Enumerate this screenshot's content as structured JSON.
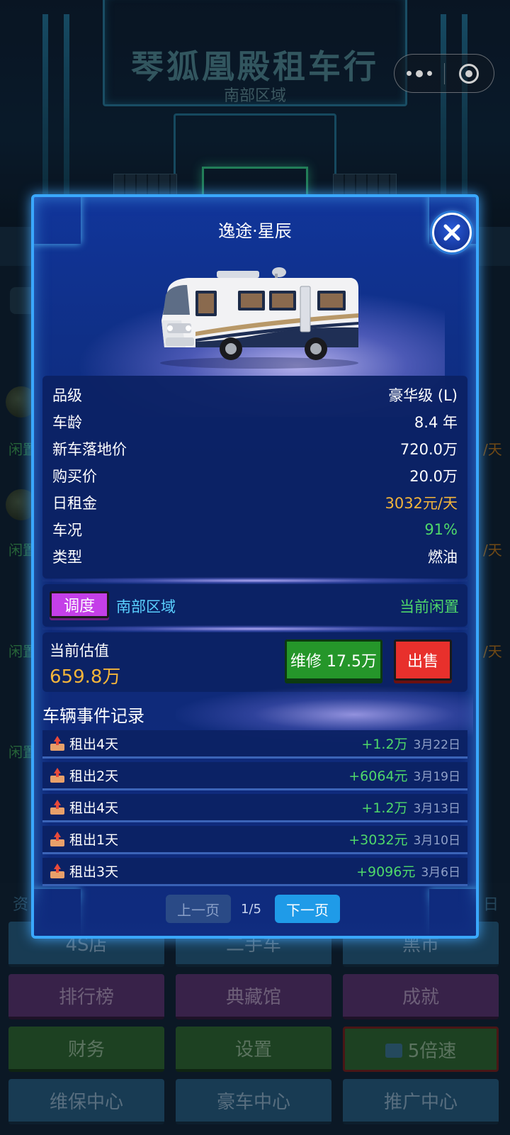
{
  "background": {
    "shop_title": "琴狐凰殿租车行",
    "region": "南部区域",
    "side_left": [
      "闲置",
      "闲置",
      "闲置",
      "闲置"
    ],
    "side_right": [
      "/天",
      "/天",
      "/天"
    ],
    "asset_label": "资",
    "date_label": "日",
    "grid_buttons": [
      {
        "label": "4S店",
        "color": "blue"
      },
      {
        "label": "二手车",
        "color": "blue"
      },
      {
        "label": "黑市",
        "color": "blue"
      },
      {
        "label": "排行榜",
        "color": "purple"
      },
      {
        "label": "典藏馆",
        "color": "purple"
      },
      {
        "label": "成就",
        "color": "purple"
      },
      {
        "label": "财务",
        "color": "green"
      },
      {
        "label": "设置",
        "color": "green"
      },
      {
        "label": "5倍速",
        "color": "green",
        "icon": "tv-icon"
      },
      {
        "label": "维保中心",
        "color": "blue"
      },
      {
        "label": "豪车中心",
        "color": "blue"
      },
      {
        "label": "推广中心",
        "color": "blue"
      }
    ]
  },
  "modal": {
    "title": "逸途·星辰",
    "vehicle_icon": "rv-motorhome",
    "info": [
      {
        "key": "品级",
        "value": "豪华级 (L)",
        "color": "white"
      },
      {
        "key": "车龄",
        "value": "8.4 年",
        "color": "white"
      },
      {
        "key": "新车落地价",
        "value": "720.0万",
        "color": "white"
      },
      {
        "key": "购买价",
        "value": "20.0万",
        "color": "white"
      },
      {
        "key": "日租金",
        "value": "3032元/天",
        "color": "#f4b53a"
      },
      {
        "key": "车况",
        "value": "91%",
        "color": "#4fd86a"
      },
      {
        "key": "类型",
        "value": "燃油",
        "color": "white"
      }
    ],
    "dispatch": {
      "button": "调度",
      "region": "南部区域",
      "status": "当前闲置"
    },
    "valuation": {
      "label": "当前估值",
      "value": "659.8万",
      "repair_button": "维修 17.5万",
      "sell_button": "出售"
    },
    "events_title": "车辆事件记录",
    "events": [
      {
        "label": "租出4天",
        "amount": "+1.2万",
        "date": "3月22日"
      },
      {
        "label": "租出2天",
        "amount": "+6064元",
        "date": "3月19日"
      },
      {
        "label": "租出4天",
        "amount": "+1.2万",
        "date": "3月13日"
      },
      {
        "label": "租出1天",
        "amount": "+3032元",
        "date": "3月10日"
      },
      {
        "label": "租出3天",
        "amount": "+9096元",
        "date": "3月6日"
      }
    ],
    "pager": {
      "prev": "上一页",
      "current": "1/5",
      "next": "下一页"
    }
  },
  "colors": {
    "accent_gold": "#f4b53a",
    "accent_green": "#4fd86a",
    "modal_border": "#3aa8ff"
  }
}
